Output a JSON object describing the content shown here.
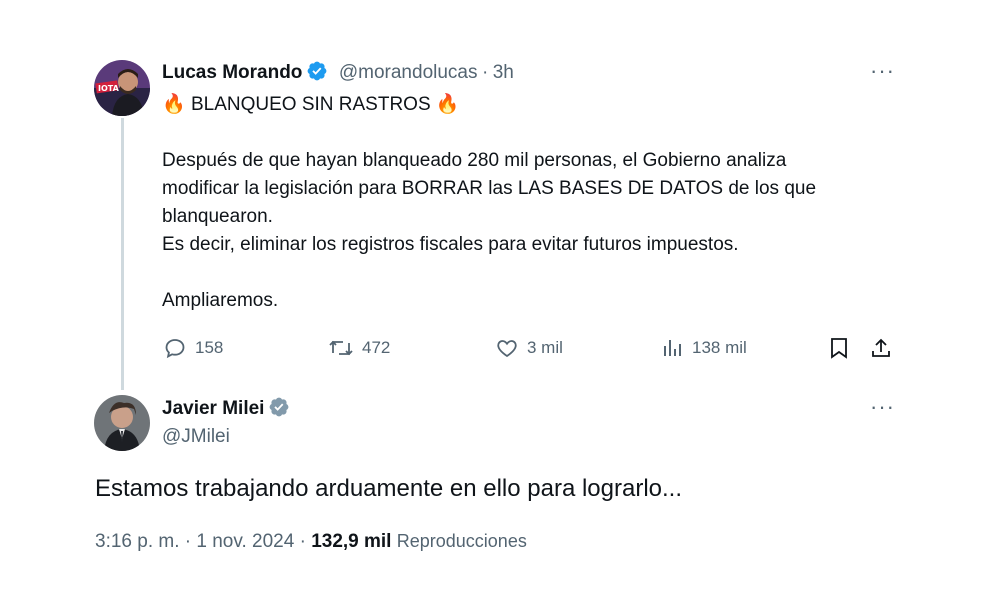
{
  "tweet1": {
    "name": "Lucas Morando",
    "handle": "@morandolucas",
    "sep": "·",
    "time": "3h",
    "title_line": "BLANQUEO SIN RASTROS",
    "emoji_left": "🔥",
    "emoji_right": "🔥",
    "para1_l1": "Después de que hayan blanqueado 280 mil personas, el Gobierno analiza",
    "para1_l2": "modificar la legislación para BORRAR las LAS BASES DE DATOS  de los que",
    "para1_l3": "blanquearon.",
    "para2": "Es decir, eliminar los registros fiscales para evitar futuros impuestos.",
    "para3": "Ampliaremos.",
    "actions": {
      "replies": "158",
      "retweets": "472",
      "likes": "3 mil",
      "views": "138 mil"
    },
    "more": "···",
    "avatar_label": "IOTA"
  },
  "tweet2": {
    "name": "Javier Milei",
    "handle": "@JMilei",
    "more": "···",
    "text": "Estamos trabajando arduamente en ello para lograrlo...",
    "time": "3:16 p. m.",
    "dot1": "·",
    "date": "1 nov. 2024",
    "dot2": "·",
    "views_count": "132,9 mil",
    "views_label": "Reproducciones"
  },
  "colors": {
    "verified_blue": "#1d9bf0",
    "verified_gray": "#829aab",
    "muted": "#536471",
    "thread": "#cfd9de"
  }
}
